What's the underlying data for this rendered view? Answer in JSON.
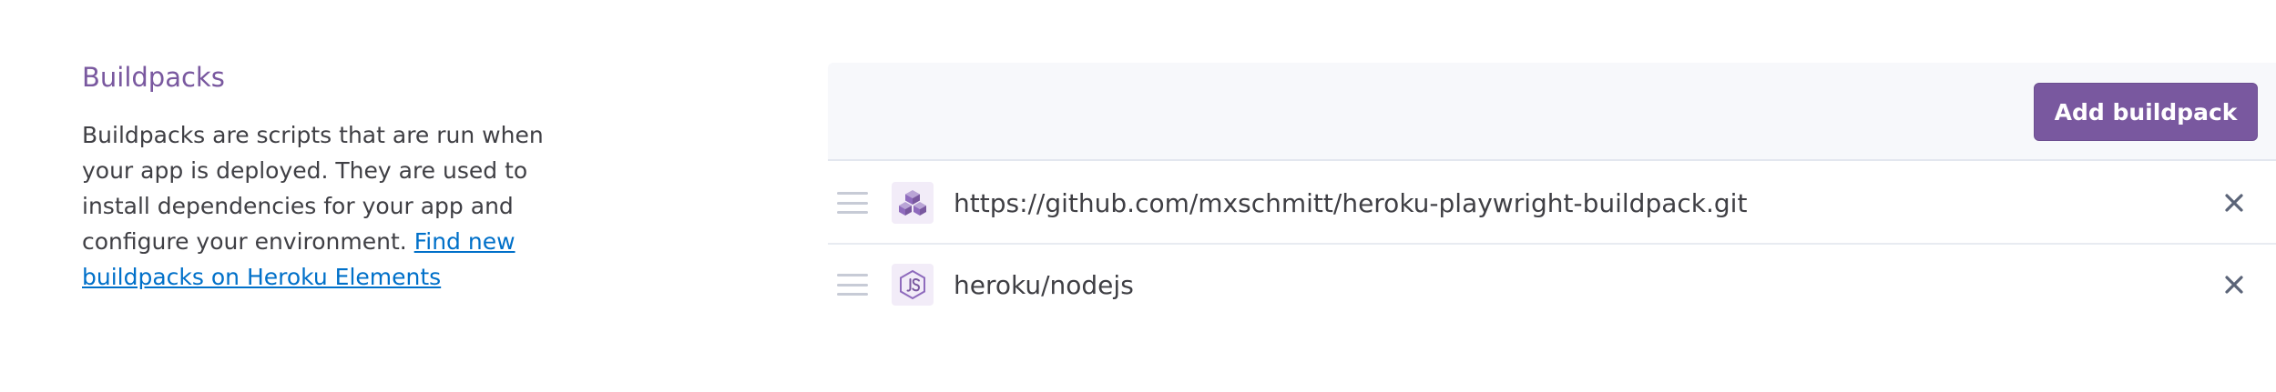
{
  "section": {
    "title": "Buildpacks",
    "description": "Buildpacks are scripts that are run when your app is deployed. They are used to install dependencies for your app and configure your environment.",
    "link_text": "Find new buildpacks on Heroku Elements"
  },
  "panel": {
    "add_button_label": "Add buildpack",
    "buildpacks": [
      {
        "name": "https://github.com/mxschmitt/heroku-playwright-buildpack.git",
        "icon": "cubes-icon"
      },
      {
        "name": "heroku/nodejs",
        "icon": "nodejs-icon"
      }
    ]
  },
  "colors": {
    "accent": "#79589f",
    "link": "#0070c9",
    "header_bg": "#f7f8fb",
    "text": "#3f3f44"
  }
}
